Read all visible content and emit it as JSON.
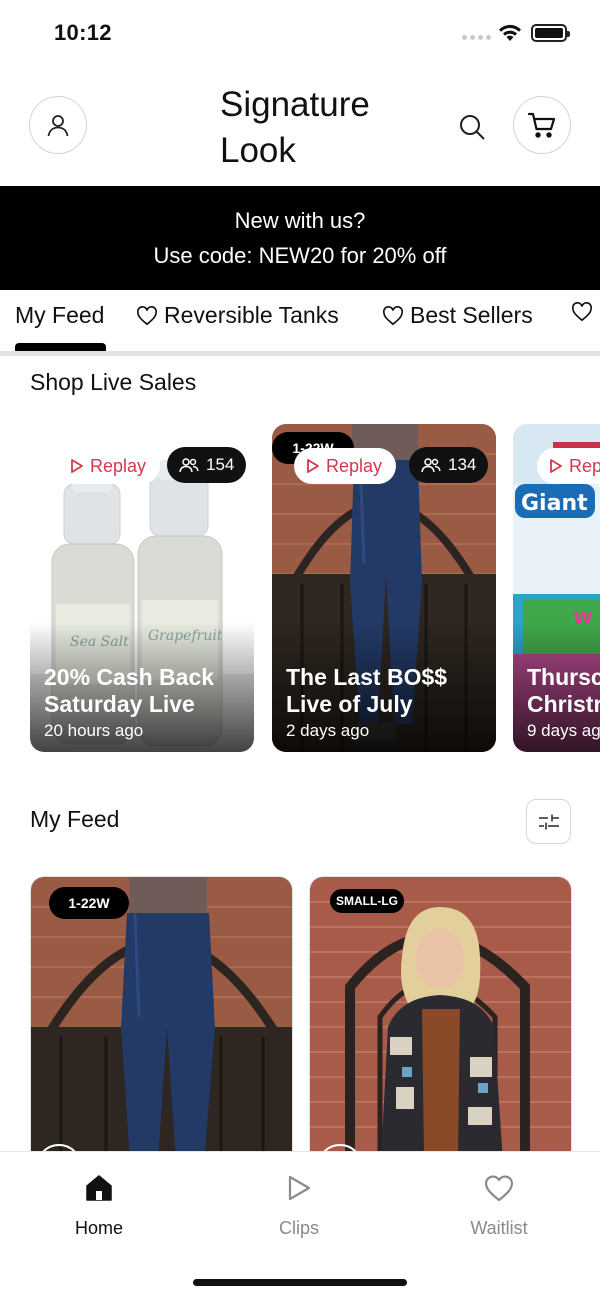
{
  "status_bar": {
    "time": "10:12"
  },
  "header": {
    "brand_line1": "Signature",
    "brand_line2": "Look"
  },
  "promo": {
    "line1": "New with us?",
    "line2": "Use code: NEW20 for 20% off"
  },
  "tabs": [
    {
      "label": "My Feed",
      "active": true
    },
    {
      "label": "Reversible Tanks",
      "heart": true
    },
    {
      "label": "Best Sellers",
      "heart": true
    }
  ],
  "live_section": {
    "title": "Shop Live Sales"
  },
  "live_cards": [
    {
      "replay": "Replay",
      "viewers": "154",
      "title": "20% Cash Back Saturday Live",
      "ago": "20 hours ago"
    },
    {
      "tag": "1-22W",
      "replay": "Replay",
      "viewers": "134",
      "title": "The Last BO$$ Live of July",
      "ago": "2 days ago"
    },
    {
      "replay": "Rep",
      "title": "Thursc Christr",
      "ago": "9 days ag",
      "brand_text": "Giant"
    }
  ],
  "feed_section": {
    "title": "My Feed"
  },
  "feed_cards": [
    {
      "tag": "1-22W"
    },
    {
      "tag": "SMALL-LG"
    }
  ],
  "bottom_nav": [
    {
      "label": "Home",
      "icon": "home-icon",
      "active": true
    },
    {
      "label": "Clips",
      "icon": "play-icon"
    },
    {
      "label": "Waitlist",
      "icon": "heart-icon"
    }
  ],
  "colors": {
    "accent_red": "#d5384a",
    "banner_bg": "#000000",
    "tab_divider": "#e2e3e6"
  }
}
